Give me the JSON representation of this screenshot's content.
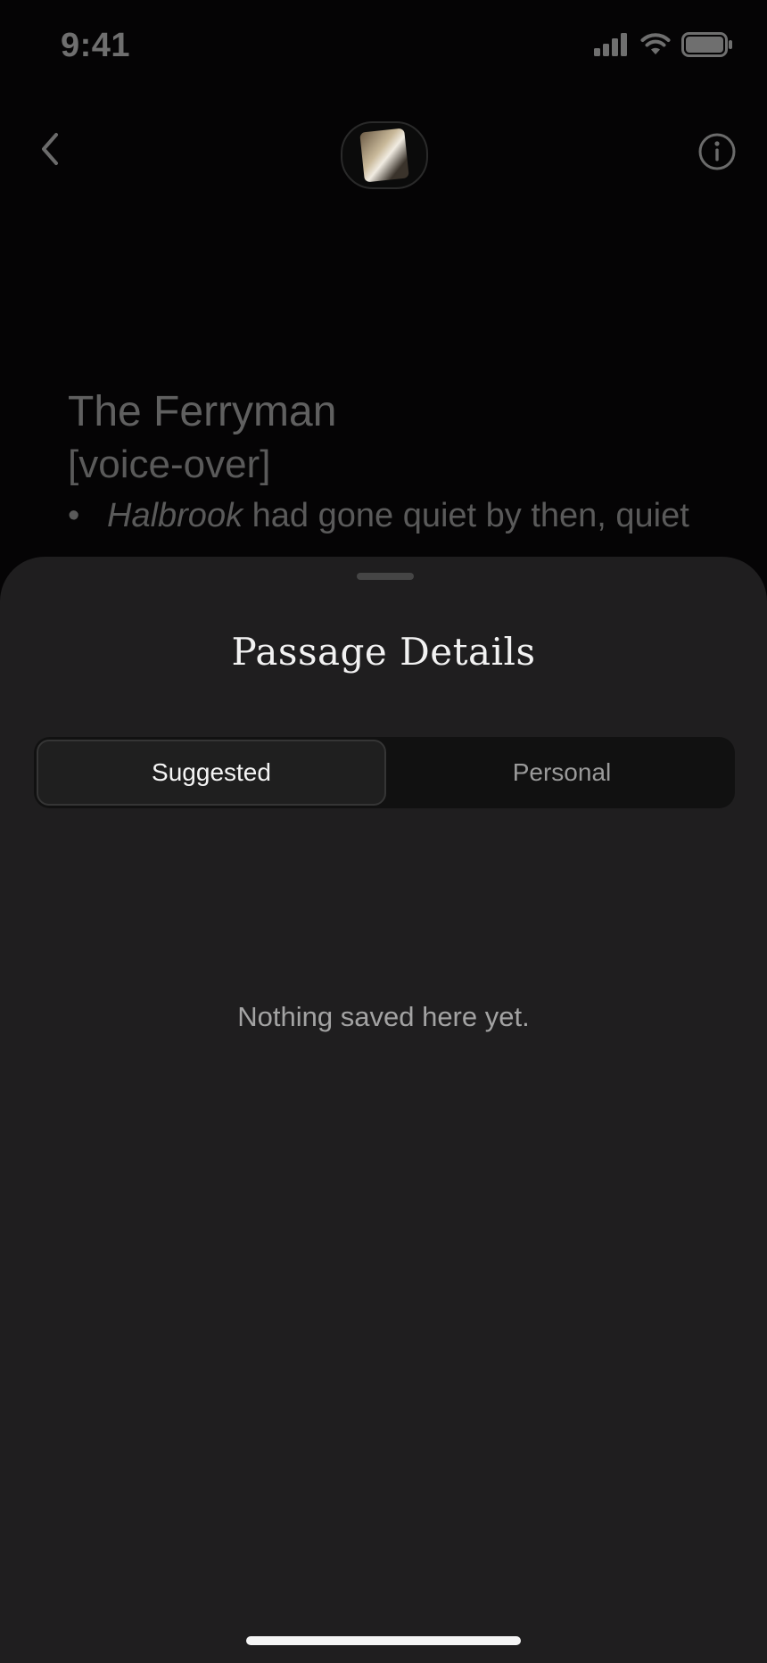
{
  "status_bar": {
    "time": "9:41",
    "icons": [
      "cellular-signal-icon",
      "wifi-icon",
      "battery-icon"
    ]
  },
  "nav": {
    "back_icon": "chevron-left-icon",
    "info_icon": "info-circle-icon"
  },
  "reading": {
    "title": "The Ferryman",
    "subtitle": "[voice-over]",
    "bullet_emphasis": "Halbrook",
    "bullet_rest": " had gone quiet by then, quiet"
  },
  "sheet": {
    "title": "Passage Details",
    "tabs": [
      {
        "label": "Suggested",
        "active": true
      },
      {
        "label": "Personal",
        "active": false
      }
    ],
    "empty_message": "Nothing saved here yet."
  },
  "colors": {
    "sheet_background": "#1f1e1f",
    "page_background": "#050405",
    "segment_track": "#111111"
  }
}
